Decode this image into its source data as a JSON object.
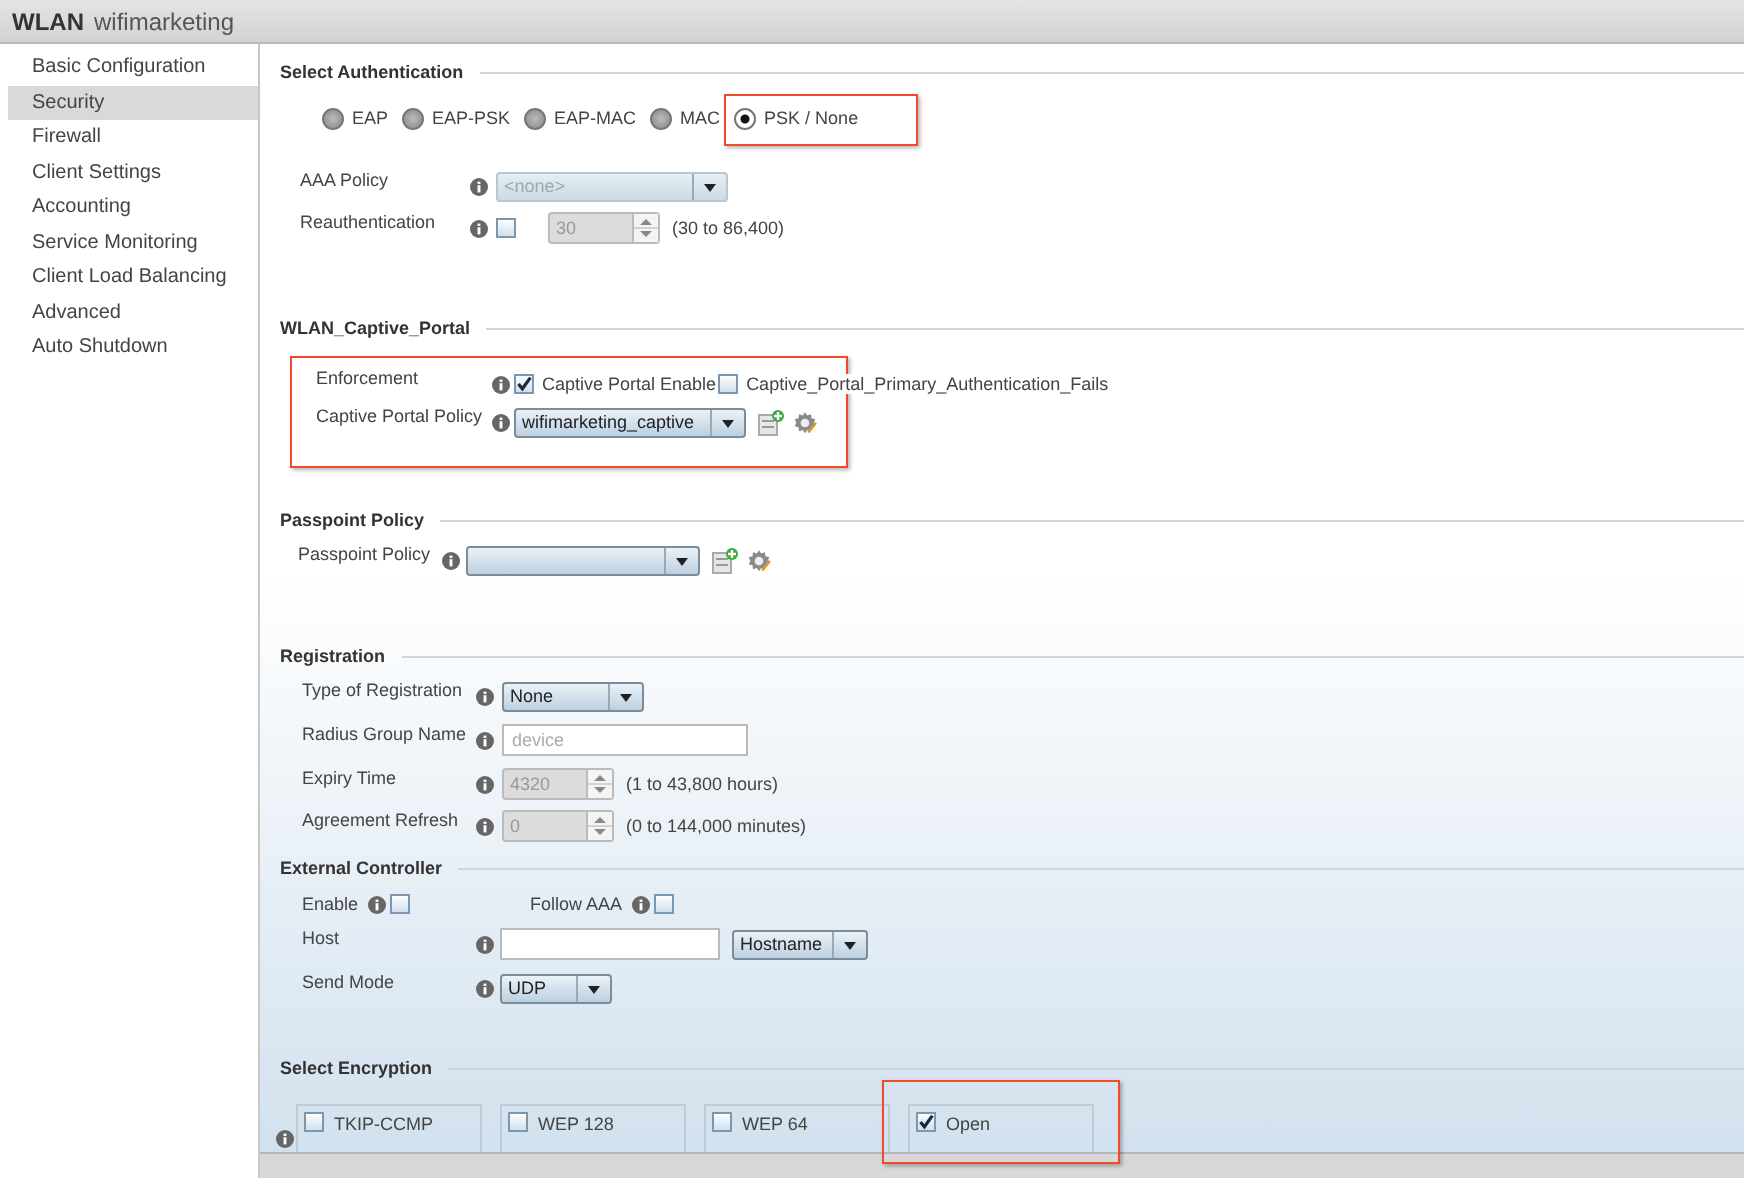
{
  "window": {
    "kind": "WLAN",
    "title": "wifimarketing"
  },
  "sidebar": {
    "items": [
      {
        "label": "Basic Configuration",
        "selected": false
      },
      {
        "label": "Security",
        "selected": true
      },
      {
        "label": "Firewall",
        "selected": false
      },
      {
        "label": "Client Settings",
        "selected": false
      },
      {
        "label": "Accounting",
        "selected": false
      },
      {
        "label": "Service Monitoring",
        "selected": false
      },
      {
        "label": "Client Load Balancing",
        "selected": false
      },
      {
        "label": "Advanced",
        "selected": false
      },
      {
        "label": "Auto Shutdown",
        "selected": false
      }
    ]
  },
  "authentication": {
    "title": "Select Authentication",
    "options": [
      {
        "label": "EAP",
        "selected": false,
        "highlighted": false
      },
      {
        "label": "EAP-PSK",
        "selected": false,
        "highlighted": false
      },
      {
        "label": "EAP-MAC",
        "selected": false,
        "highlighted": false
      },
      {
        "label": "MAC",
        "selected": false,
        "highlighted": false
      },
      {
        "label": "PSK / None",
        "selected": true,
        "highlighted": true
      }
    ],
    "aaa_policy": {
      "label": "AAA Policy",
      "value": "<none>",
      "disabled": true
    },
    "reauthentication": {
      "label": "Reauthentication",
      "checked": false,
      "value": "30",
      "disabled": true,
      "range": "(30 to 86,400)"
    }
  },
  "captive_portal": {
    "title": "WLAN_Captive_Portal",
    "highlighted": true,
    "enforcement": {
      "label": "Enforcement",
      "options": [
        {
          "label": "Captive Portal Enable",
          "checked": true
        },
        {
          "label": "Captive_Portal_Primary_Authentication_Fails",
          "checked": false
        }
      ]
    },
    "policy": {
      "label": "Captive Portal Policy",
      "value": "wifimarketing_captive"
    }
  },
  "passpoint": {
    "title": "Passpoint Policy",
    "policy": {
      "label": "Passpoint Policy"
    }
  },
  "registration": {
    "title": "Registration",
    "type": {
      "label": "Type of Registration",
      "value": "None"
    },
    "radius_group": {
      "label": "Radius Group Name",
      "placeholder": "device"
    },
    "expiry": {
      "label": "Expiry Time",
      "value": "4320",
      "disabled": true,
      "range": "(1 to 43,800 hours)"
    },
    "agreement_refresh": {
      "label": "Agreement Refresh",
      "value": "0",
      "disabled": true,
      "range": "(0 to 144,000 minutes)"
    }
  },
  "external_controller": {
    "title": "External Controller",
    "enable": {
      "label": "Enable",
      "checked": false
    },
    "follow_aaa": {
      "label": "Follow AAA",
      "checked": false
    },
    "host": {
      "label": "Host",
      "type": "Hostname"
    },
    "send_mode": {
      "label": "Send Mode",
      "value": "UDP"
    }
  },
  "encryption": {
    "title": "Select Encryption",
    "options": [
      {
        "label": "TKIP-CCMP",
        "checked": false,
        "highlighted": false
      },
      {
        "label": "WEP 128",
        "checked": false,
        "highlighted": false
      },
      {
        "label": "WEP 64",
        "checked": false,
        "highlighted": false
      },
      {
        "label": "Open",
        "checked": true,
        "highlighted": true
      }
    ]
  }
}
